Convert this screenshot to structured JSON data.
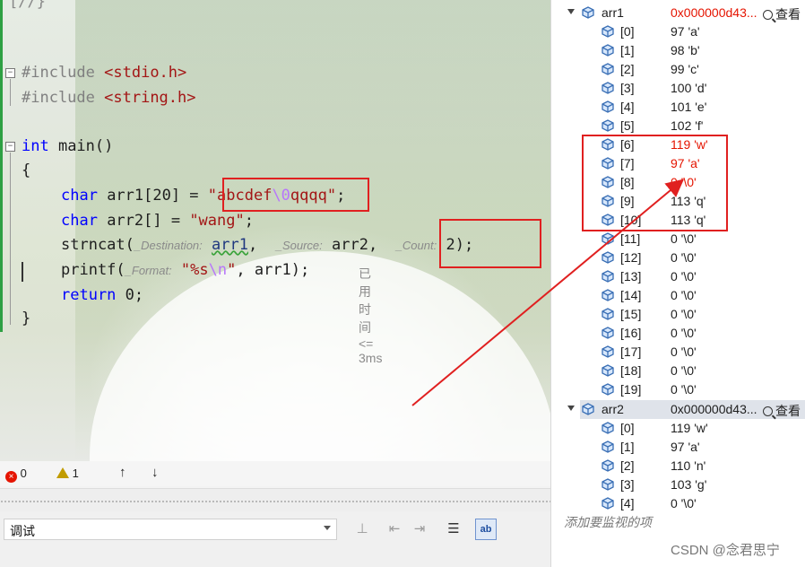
{
  "editor": {
    "top_fragment": "[//}",
    "include1_kw": "#include",
    "include1_hdr": "<stdio.h>",
    "include2_kw": "#include",
    "include2_hdr": "<string.h>",
    "main_kw": "int",
    "main_rest": " main()",
    "brace_open": "{",
    "line_arr1": {
      "type": "char",
      "decl": " arr1[20] = ",
      "str_a": "\"abcdef",
      "esc": "\\0",
      "str_b": "qqqq\"",
      "end": ";"
    },
    "line_arr2": {
      "type": "char",
      "decl": " arr2[] = ",
      "str": "\"wang\"",
      "end": ";"
    },
    "line_strncat": {
      "fn": "strncat(",
      "hint_dest": "_Destination:",
      "arg1": "arr1",
      "comma1": ",",
      "hint_src": "_Source:",
      "arg2": "arr2,",
      "hint_count": "_Count:",
      "arg3": "2);"
    },
    "line_printf": {
      "fn": "printf(",
      "hint_fmt": "_Format:",
      "str_a": "\"%s",
      "esc": "\\n",
      "str_b": "\"",
      "rest": ", arr1);",
      "perf": "已用时间 <= 3ms"
    },
    "line_return": {
      "kw": "return",
      "rest": " 0;"
    },
    "brace_close": "}"
  },
  "status": {
    "errors": "0",
    "warnings": "1",
    "up": "↑",
    "down": "↓"
  },
  "bottom": {
    "config_value": "调试"
  },
  "watch": {
    "arr1": {
      "name": "arr1",
      "value": "0x000000d43...",
      "view": "查看"
    },
    "arr1_items": [
      {
        "idx": "[0]",
        "val": "97 'a'",
        "red": false
      },
      {
        "idx": "[1]",
        "val": "98 'b'",
        "red": false
      },
      {
        "idx": "[2]",
        "val": "99 'c'",
        "red": false
      },
      {
        "idx": "[3]",
        "val": "100 'd'",
        "red": false
      },
      {
        "idx": "[4]",
        "val": "101 'e'",
        "red": false
      },
      {
        "idx": "[5]",
        "val": "102 'f'",
        "red": false
      },
      {
        "idx": "[6]",
        "val": "119 'w'",
        "red": true
      },
      {
        "idx": "[7]",
        "val": "97 'a'",
        "red": true
      },
      {
        "idx": "[8]",
        "val": "0 '\\0'",
        "red": true
      },
      {
        "idx": "[9]",
        "val": "113 'q'",
        "red": false
      },
      {
        "idx": "[10]",
        "val": "113 'q'",
        "red": false
      },
      {
        "idx": "[11]",
        "val": "0 '\\0'",
        "red": false
      },
      {
        "idx": "[12]",
        "val": "0 '\\0'",
        "red": false
      },
      {
        "idx": "[13]",
        "val": "0 '\\0'",
        "red": false
      },
      {
        "idx": "[14]",
        "val": "0 '\\0'",
        "red": false
      },
      {
        "idx": "[15]",
        "val": "0 '\\0'",
        "red": false
      },
      {
        "idx": "[16]",
        "val": "0 '\\0'",
        "red": false
      },
      {
        "idx": "[17]",
        "val": "0 '\\0'",
        "red": false
      },
      {
        "idx": "[18]",
        "val": "0 '\\0'",
        "red": false
      },
      {
        "idx": "[19]",
        "val": "0 '\\0'",
        "red": false
      }
    ],
    "arr2": {
      "name": "arr2",
      "value": "0x000000d43...",
      "view": "查看"
    },
    "arr2_items": [
      {
        "idx": "[0]",
        "val": "119 'w'"
      },
      {
        "idx": "[1]",
        "val": "97 'a'"
      },
      {
        "idx": "[2]",
        "val": "110 'n'"
      },
      {
        "idx": "[3]",
        "val": "103 'g'"
      },
      {
        "idx": "[4]",
        "val": "0 '\\0'"
      }
    ],
    "add_watch": "添加要监视的项"
  },
  "watermark": "CSDN @念君思宁",
  "colors": {
    "changed_value": "#e51400",
    "annotation": "#e02020",
    "keyword": "#0000ff",
    "string": "#a31515"
  }
}
